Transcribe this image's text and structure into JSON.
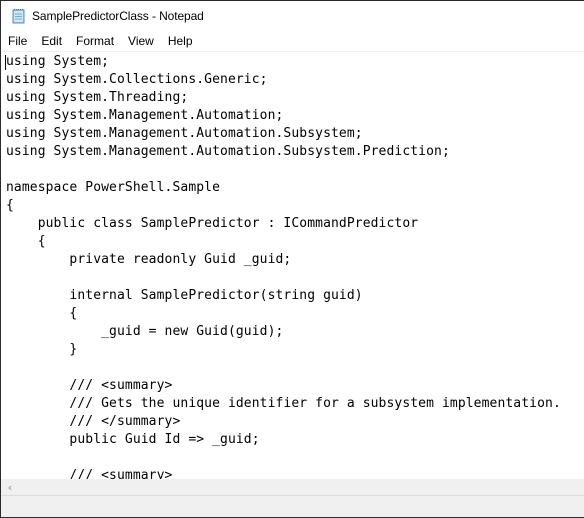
{
  "window": {
    "title": "SamplePredictorClass - Notepad",
    "icon": "notepad-icon"
  },
  "menubar": {
    "items": [
      {
        "label": "File"
      },
      {
        "label": "Edit"
      },
      {
        "label": "Format"
      },
      {
        "label": "View"
      },
      {
        "label": "Help"
      }
    ]
  },
  "editor": {
    "lines": [
      "using System;",
      "using System.Collections.Generic;",
      "using System.Threading;",
      "using System.Management.Automation;",
      "using System.Management.Automation.Subsystem;",
      "using System.Management.Automation.Subsystem.Prediction;",
      "",
      "namespace PowerShell.Sample",
      "{",
      "    public class SamplePredictor : ICommandPredictor",
      "    {",
      "        private readonly Guid _guid;",
      "",
      "        internal SamplePredictor(string guid)",
      "        {",
      "            _guid = new Guid(guid);",
      "        }",
      "",
      "        /// <summary>",
      "        /// Gets the unique identifier for a subsystem implementation.",
      "        /// </summary>",
      "        public Guid Id => _guid;",
      "",
      "        /// <summary>"
    ]
  },
  "scrollbar": {
    "left_arrow": "‹"
  }
}
